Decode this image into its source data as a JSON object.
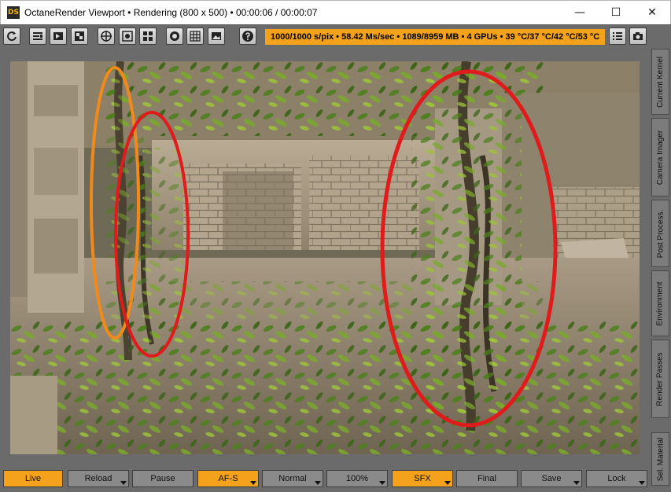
{
  "window": {
    "app_icon_text": "DS",
    "title": "OctaneRender Viewport • Rendering (800 x 500) • 00:00:06 / 00:00:07",
    "controls": {
      "minimize": "—",
      "maximize": "☐",
      "close": "✕"
    }
  },
  "toolbar": {
    "buttons": [
      "reload-icon",
      "region-render-icon",
      "film-region-icon",
      "pick-icon",
      "focus-picker-icon",
      "white-balance-icon",
      "material-picker-icon",
      "stop-icon",
      "grid-icon",
      "save-image-icon",
      "help-icon",
      "menu-icon",
      "camera-icon"
    ],
    "status": "1000/1000 s/pix • 58.42 Ms/sec • 1089/8959 MB • 4 GPUs • 39 °C/37 °C/42 °C/53 °C"
  },
  "side_tabs": [
    "Current Kernel",
    "Camera Imager",
    "Post Process.",
    "Environment",
    "Render Passes",
    "Sel. Material"
  ],
  "bottom_controls": [
    {
      "label": "Live",
      "active": true,
      "dropdown": false
    },
    {
      "label": "Reload",
      "active": false,
      "dropdown": true
    },
    {
      "label": "Pause",
      "active": false,
      "dropdown": false
    },
    {
      "label": "AF-S",
      "active": true,
      "dropdown": true
    },
    {
      "label": "Normal",
      "active": false,
      "dropdown": true
    },
    {
      "label": "100%",
      "active": false,
      "dropdown": true
    },
    {
      "label": "SFX",
      "active": true,
      "dropdown": true
    },
    {
      "label": "Final",
      "active": false,
      "dropdown": false
    },
    {
      "label": "Save",
      "active": false,
      "dropdown": true
    },
    {
      "label": "Lock",
      "active": false,
      "dropdown": true
    }
  ],
  "colors": {
    "accent": "#f4a21c",
    "annotation_red": "#e01b1b",
    "annotation_orange": "#f08a1c",
    "panel": "#6b6b6b"
  }
}
